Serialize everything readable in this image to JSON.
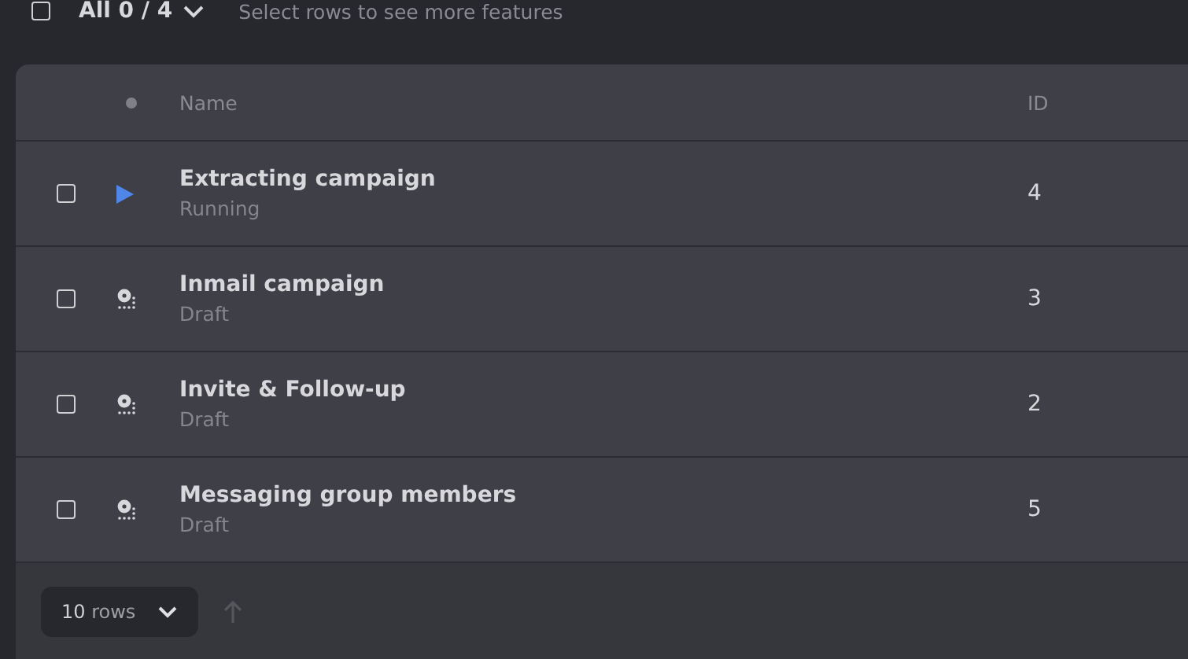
{
  "toolbar": {
    "select_all": {
      "checked": false
    },
    "selection": "All 0 / 4",
    "hint": "Select rows to see more features"
  },
  "table": {
    "columns": [
      {
        "label": "Name"
      },
      {
        "label": "ID"
      }
    ],
    "rows": [
      {
        "checked": false,
        "kind": "running",
        "name": "Extracting campaign",
        "state": "Running",
        "id": "4"
      },
      {
        "checked": false,
        "kind": "draft",
        "name": "Inmail campaign",
        "state": "Draft",
        "id": "3"
      },
      {
        "checked": false,
        "kind": "draft",
        "name": "Invite & Follow-up",
        "state": "Draft",
        "id": "2"
      },
      {
        "checked": false,
        "kind": "draft",
        "name": "Messaging group members",
        "state": "Draft",
        "id": "5"
      }
    ]
  },
  "footer": {
    "page_size": "10",
    "page_size_unit": "rows"
  }
}
